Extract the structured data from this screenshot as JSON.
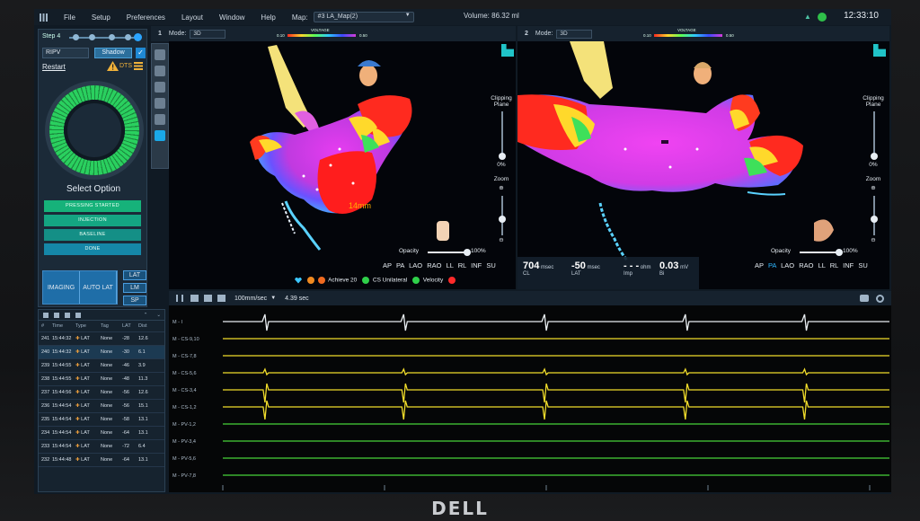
{
  "menu": [
    "File",
    "Setup",
    "Preferences",
    "Layout",
    "Window",
    "Help"
  ],
  "map_label": "Map:",
  "map_value": "#3 LA_Map(2)",
  "volume": "Volume: 86.32 ml",
  "clock": "12:33:10",
  "left": {
    "step": "Step 4",
    "chamber": "RIPV",
    "shadow": "Shadow",
    "restart": "Restart",
    "dts": "DTS",
    "select_option": "Select Option",
    "options": [
      "PRESSING STARTED",
      "INJECTION",
      "BASELINE",
      "DONE"
    ],
    "imaging": "IMAGING",
    "autolat": "AUTO LAT",
    "side_buttons": [
      "LAT",
      "LM",
      "SP"
    ]
  },
  "viewport1": {
    "num": "1",
    "mode_label": "Mode:",
    "mode": "3D",
    "scale": "14mm",
    "cbar_lo": "0.10",
    "cbar_hi": "0.50",
    "cbar_title": "VOLTAGE",
    "clipping": "Clipping Plane",
    "clip_pct": "0%",
    "zoom": "Zoom",
    "opacity": "Opacity",
    "opacity_pct": "100%",
    "views": [
      "AP",
      "PA",
      "LAO",
      "RAO",
      "LL",
      "RL",
      "INF",
      "SU"
    ]
  },
  "viewport2": {
    "num": "2",
    "mode_label": "Mode:",
    "mode": "3D",
    "cbar_lo": "0.10",
    "cbar_hi": "0.50",
    "cbar_title": "VOLTAGE",
    "clipping": "Clipping Plane",
    "clip_pct": "0%",
    "zoom": "Zoom",
    "opacity": "Opacity",
    "opacity_pct": "100%",
    "views": [
      "AP",
      "PA",
      "LAO",
      "RAO",
      "LL",
      "RL",
      "INF",
      "SU"
    ],
    "selected_view": "PA"
  },
  "legend": {
    "achieve": "Achieve 20",
    "cs": "CS Unilateral",
    "velocity": "Velocity"
  },
  "readouts": {
    "cl": "704",
    "cl_unit": "msec",
    "cl_label": "CL",
    "lat": "-50",
    "lat_unit": "msec",
    "lat_label": "LAT",
    "imp": "- - -",
    "imp_unit": "ohm",
    "imp_label": "Imp",
    "bi": "0.03",
    "bi_unit": "mV",
    "bi_label": "Bi"
  },
  "ecg": {
    "speed": "100mm/sec",
    "duration": "4.39 sec",
    "channels": [
      "M - I",
      "M - CS-9,10",
      "M - CS-7,8",
      "M - CS-5,6",
      "M - CS-3,4",
      "M - CS-1,2",
      "M - PV-1,2",
      "M - PV-3,4",
      "M - PV-5,6",
      "M - PV-7,8"
    ],
    "colors": [
      "#e9eef2",
      "#f0dc2b",
      "#f0dc2b",
      "#f0dc2b",
      "#f0dc2b",
      "#f0dc2b",
      "#47d23a",
      "#47d23a",
      "#47d23a",
      "#47d23a"
    ],
    "beats": [
      0.133,
      0.325,
      0.52,
      0.715,
      0.88
    ]
  },
  "table": {
    "headers": [
      "#",
      "Time",
      "Type",
      "Tag",
      "LAT",
      "Dist"
    ],
    "rows": [
      [
        "241",
        "15:44:32",
        "LAT",
        "None",
        "-28",
        "12.6"
      ],
      [
        "240",
        "15:44:32",
        "LAT",
        "None",
        "-30",
        "6.1"
      ],
      [
        "239",
        "15:44:55",
        "LAT",
        "None",
        "-46",
        "3.9"
      ],
      [
        "238",
        "15:44:55",
        "LAT",
        "None",
        "-48",
        "11.3"
      ],
      [
        "237",
        "15:44:56",
        "LAT",
        "None",
        "-56",
        "12.6"
      ],
      [
        "236",
        "15:44:54",
        "LAT",
        "None",
        "-56",
        "15.1"
      ],
      [
        "235",
        "15:44:54",
        "LAT",
        "None",
        "-58",
        "13.1"
      ],
      [
        "234",
        "15:44:54",
        "LAT",
        "None",
        "-64",
        "13.1"
      ],
      [
        "233",
        "15:44:54",
        "LAT",
        "None",
        "-72",
        "6.4"
      ],
      [
        "232",
        "15:44:48",
        "LAT",
        "None",
        "-64",
        "13.1"
      ]
    ]
  },
  "brand": "DELL"
}
